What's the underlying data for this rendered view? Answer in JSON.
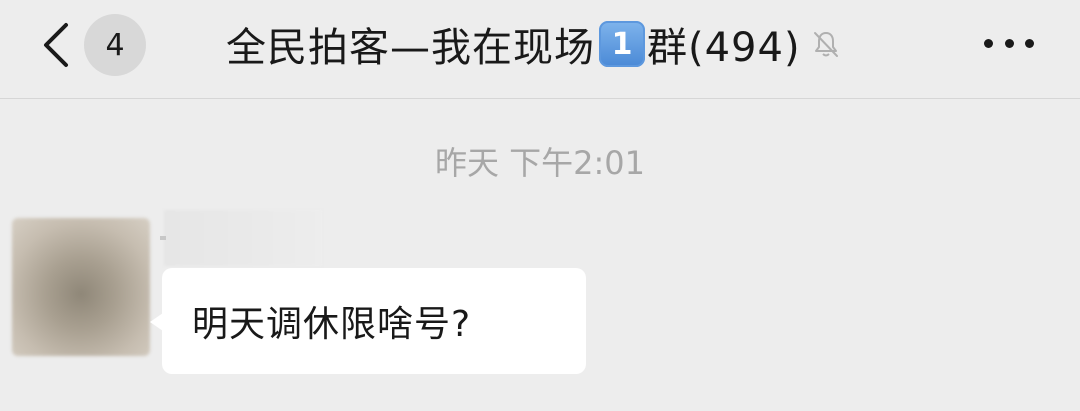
{
  "header": {
    "back_icon": "chevron-left-icon",
    "unread_count": "4",
    "title_prefix": "全民拍客—我在现场",
    "title_emoji": "1",
    "title_suffix": "群(494)",
    "mute_icon": "muted-bell-icon",
    "more_icon": "more-dots-icon"
  },
  "chat": {
    "timestamp": "昨天 下午2:01",
    "messages": [
      {
        "text": "明天调休限啥号?"
      }
    ]
  },
  "colors": {
    "background": "#ededed",
    "bubble": "#ffffff",
    "title_text": "#191919",
    "timestamp_text": "#a7a7a7",
    "emoji_blue": "#4a89d6"
  }
}
